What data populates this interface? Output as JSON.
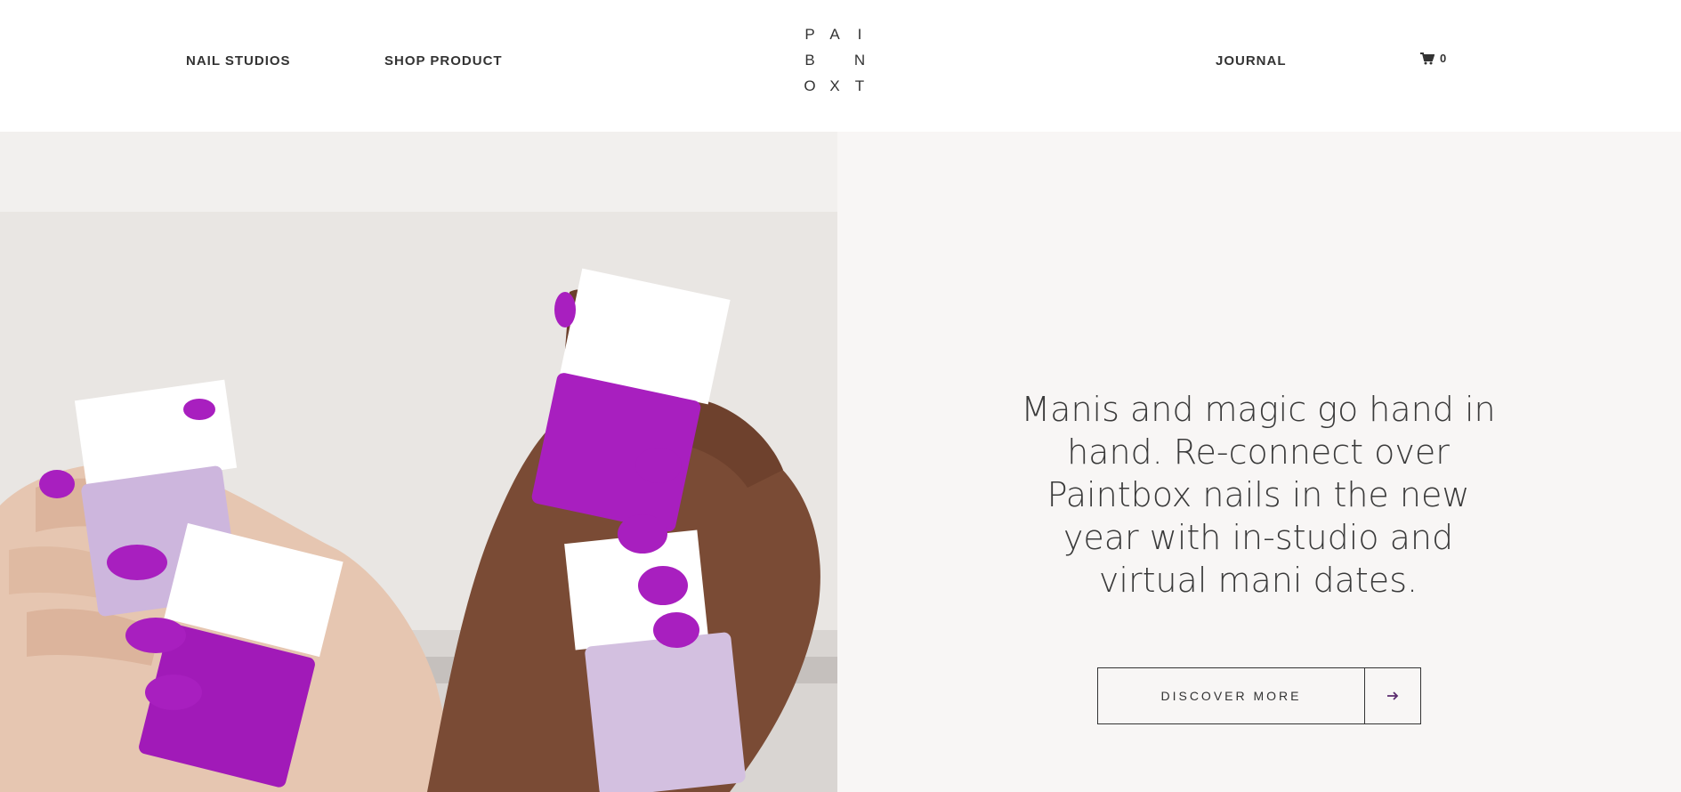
{
  "header": {
    "nav_left": [
      "NAIL STUDIOS",
      "SHOP PRODUCT"
    ],
    "nav_right": [
      "JOURNAL"
    ],
    "cart_count": "0",
    "logo_letters": [
      "P",
      "A",
      "I",
      "B",
      "",
      "N",
      "O",
      "X",
      "T"
    ]
  },
  "hero": {
    "headline": "Manis and magic go hand in hand. Re-connect over Paintbox nails in the new year with in-studio and virtual mani dates.",
    "cta_label": "DISCOVER MORE",
    "image_alt": "Hands with purple manicures holding Paintbox nail polish bottles"
  },
  "colors": {
    "text": "#333333",
    "panel_bg": "#f8f6f5",
    "accent_purple": "#a81fbf",
    "lilac": "#cdb6dd"
  },
  "icons": {
    "cart": "cart-icon",
    "arrow": "arrow-right-icon"
  }
}
